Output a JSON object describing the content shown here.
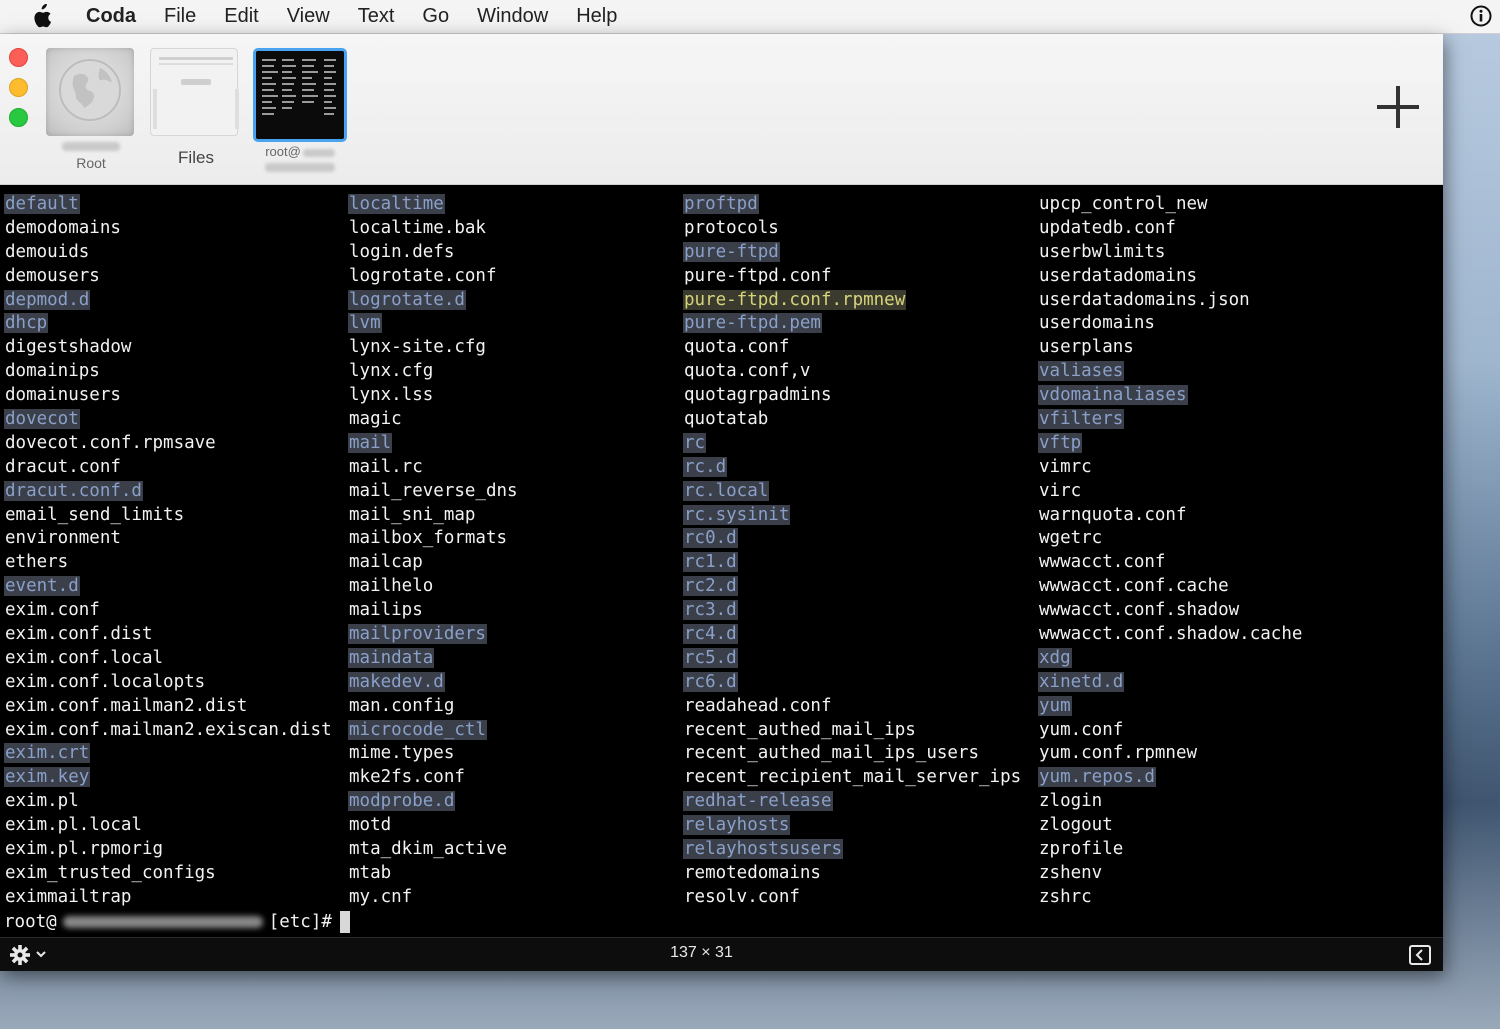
{
  "menubar": {
    "app_name": "Coda",
    "items": [
      "File",
      "Edit",
      "View",
      "Text",
      "Go",
      "Window",
      "Help"
    ],
    "apple_icon": "apple-logo-icon",
    "info_icon": "info-icon"
  },
  "toolbar": {
    "sites": [
      {
        "label": "Root",
        "icon": "globe-icon"
      },
      {
        "label": "Files",
        "icon": "file-browser-icon"
      },
      {
        "label": "root@",
        "icon": "terminal-thumbnail-icon"
      }
    ],
    "add_icon": "plus-icon"
  },
  "colors": {
    "directory_fg": "#8aa0c8",
    "directory_bg": "#3a3f4a",
    "highlight_fg": "#d7d37a",
    "selected_border": "#4aa3f0"
  },
  "terminal": {
    "columns": [
      [
        {
          "t": "default",
          "k": "dir"
        },
        {
          "t": "demodomains"
        },
        {
          "t": "demouids"
        },
        {
          "t": "demousers"
        },
        {
          "t": "depmod.d",
          "k": "dir"
        },
        {
          "t": "dhcp",
          "k": "dir"
        },
        {
          "t": "digestshadow"
        },
        {
          "t": "domainips"
        },
        {
          "t": "domainusers"
        },
        {
          "t": "dovecot",
          "k": "dir"
        },
        {
          "t": "dovecot.conf.rpmsave"
        },
        {
          "t": "dracut.conf"
        },
        {
          "t": "dracut.conf.d",
          "k": "dir"
        },
        {
          "t": "email_send_limits"
        },
        {
          "t": "environment"
        },
        {
          "t": "ethers"
        },
        {
          "t": "event.d",
          "k": "dir"
        },
        {
          "t": "exim.conf"
        },
        {
          "t": "exim.conf.dist"
        },
        {
          "t": "exim.conf.local"
        },
        {
          "t": "exim.conf.localopts"
        },
        {
          "t": "exim.conf.mailman2.dist"
        },
        {
          "t": "exim.conf.mailman2.exiscan.dist"
        },
        {
          "t": "exim.crt",
          "k": "dir"
        },
        {
          "t": "exim.key",
          "k": "dir"
        },
        {
          "t": "exim.pl"
        },
        {
          "t": "exim.pl.local"
        },
        {
          "t": "exim.pl.rpmorig"
        },
        {
          "t": "exim_trusted_configs"
        },
        {
          "t": "eximmailtrap"
        }
      ],
      [
        {
          "t": "localtime",
          "k": "dir"
        },
        {
          "t": "localtime.bak"
        },
        {
          "t": "login.defs"
        },
        {
          "t": "logrotate.conf"
        },
        {
          "t": "logrotate.d",
          "k": "dir"
        },
        {
          "t": "lvm",
          "k": "dir"
        },
        {
          "t": "lynx-site.cfg"
        },
        {
          "t": "lynx.cfg"
        },
        {
          "t": "lynx.lss"
        },
        {
          "t": "magic"
        },
        {
          "t": "mail",
          "k": "dir"
        },
        {
          "t": "mail.rc"
        },
        {
          "t": "mail_reverse_dns"
        },
        {
          "t": "mail_sni_map"
        },
        {
          "t": "mailbox_formats"
        },
        {
          "t": "mailcap"
        },
        {
          "t": "mailhelo"
        },
        {
          "t": "mailips"
        },
        {
          "t": "mailproviders",
          "k": "dir"
        },
        {
          "t": "maindata",
          "k": "dir"
        },
        {
          "t": "makedev.d",
          "k": "dir"
        },
        {
          "t": "man.config"
        },
        {
          "t": "microcode_ctl",
          "k": "dir"
        },
        {
          "t": "mime.types"
        },
        {
          "t": "mke2fs.conf"
        },
        {
          "t": "modprobe.d",
          "k": "dir"
        },
        {
          "t": "motd"
        },
        {
          "t": "mta_dkim_active"
        },
        {
          "t": "mtab"
        },
        {
          "t": "my.cnf"
        }
      ],
      [
        {
          "t": "proftpd",
          "k": "dir"
        },
        {
          "t": "protocols"
        },
        {
          "t": "pure-ftpd",
          "k": "dir"
        },
        {
          "t": "pure-ftpd.conf"
        },
        {
          "t": "pure-ftpd.conf.rpmnew",
          "k": "pkg"
        },
        {
          "t": "pure-ftpd.pem",
          "k": "dir"
        },
        {
          "t": "quota.conf"
        },
        {
          "t": "quota.conf,v"
        },
        {
          "t": "quotagrpadmins"
        },
        {
          "t": "quotatab"
        },
        {
          "t": "rc",
          "k": "dir"
        },
        {
          "t": "rc.d",
          "k": "dir"
        },
        {
          "t": "rc.local",
          "k": "dir"
        },
        {
          "t": "rc.sysinit",
          "k": "dir"
        },
        {
          "t": "rc0.d",
          "k": "dir"
        },
        {
          "t": "rc1.d",
          "k": "dir"
        },
        {
          "t": "rc2.d",
          "k": "dir"
        },
        {
          "t": "rc3.d",
          "k": "dir"
        },
        {
          "t": "rc4.d",
          "k": "dir"
        },
        {
          "t": "rc5.d",
          "k": "dir"
        },
        {
          "t": "rc6.d",
          "k": "dir"
        },
        {
          "t": "readahead.conf"
        },
        {
          "t": "recent_authed_mail_ips"
        },
        {
          "t": "recent_authed_mail_ips_users"
        },
        {
          "t": "recent_recipient_mail_server_ips"
        },
        {
          "t": "redhat-release",
          "k": "dir"
        },
        {
          "t": "relayhosts",
          "k": "dir"
        },
        {
          "t": "relayhostsusers",
          "k": "dir"
        },
        {
          "t": "remotedomains"
        },
        {
          "t": "resolv.conf"
        }
      ],
      [
        {
          "t": "upcp_control_new"
        },
        {
          "t": "updatedb.conf"
        },
        {
          "t": "userbwlimits"
        },
        {
          "t": "userdatadomains"
        },
        {
          "t": "userdatadomains.json"
        },
        {
          "t": "userdomains"
        },
        {
          "t": "userplans"
        },
        {
          "t": "valiases",
          "k": "dir"
        },
        {
          "t": "vdomainaliases",
          "k": "dir"
        },
        {
          "t": "vfilters",
          "k": "dir"
        },
        {
          "t": "vftp",
          "k": "dir"
        },
        {
          "t": "vimrc"
        },
        {
          "t": "virc"
        },
        {
          "t": "warnquota.conf"
        },
        {
          "t": "wgetrc"
        },
        {
          "t": "wwwacct.conf"
        },
        {
          "t": "wwwacct.conf.cache"
        },
        {
          "t": "wwwacct.conf.shadow"
        },
        {
          "t": "wwwacct.conf.shadow.cache"
        },
        {
          "t": "xdg",
          "k": "dir"
        },
        {
          "t": "xinetd.d",
          "k": "dir"
        },
        {
          "t": "yum",
          "k": "dir"
        },
        {
          "t": "yum.conf"
        },
        {
          "t": "yum.conf.rpmnew"
        },
        {
          "t": "yum.repos.d",
          "k": "dir"
        },
        {
          "t": "zlogin"
        },
        {
          "t": "zlogout"
        },
        {
          "t": "zprofile"
        },
        {
          "t": "zshenv"
        },
        {
          "t": "zshrc"
        }
      ]
    ],
    "prompt_user": "root@",
    "prompt_dir": "[etc]#"
  },
  "statusbar": {
    "dimensions": "137 × 31",
    "settings_icon": "gear-icon",
    "panel_icon": "sidebar-toggle-icon"
  }
}
